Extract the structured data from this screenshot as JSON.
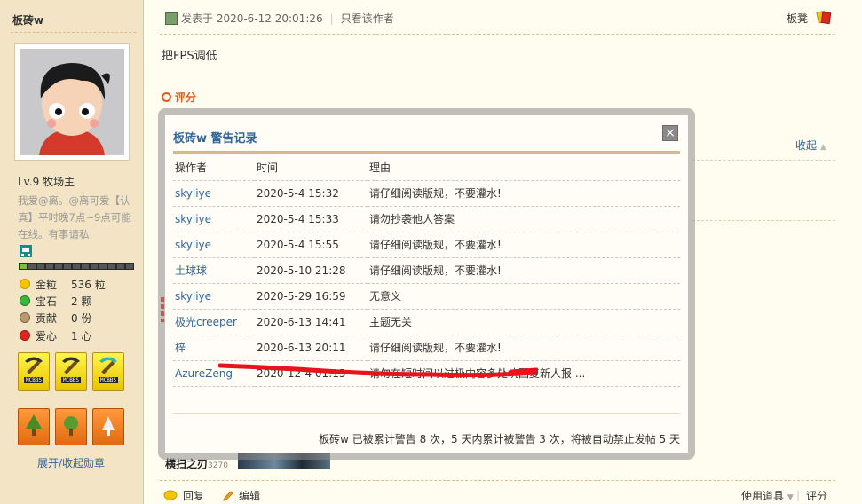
{
  "sidebar": {
    "username": "板砖w",
    "level": "Lv.9 牧场主",
    "bio": "我爱@离。@离可爱【认真】平时晚7点~9点可能在线。有事请私",
    "xp_fraction": 0.06,
    "stats": [
      {
        "icon": "gold-coin-icon",
        "color": "#f5c400",
        "label": "金粒",
        "value": "536 粒"
      },
      {
        "icon": "gem-icon",
        "color": "#3ab83a",
        "label": "宝石",
        "value": "2 颗"
      },
      {
        "icon": "contribution-icon",
        "color": "#b99a6e",
        "label": "贡献",
        "value": "0 份"
      },
      {
        "icon": "heart-apple-icon",
        "color": "#e0261e",
        "label": "爱心",
        "value": "1 心"
      }
    ],
    "medal_tag": "MCBBS",
    "toggle_medals": "展开/收起勋章"
  },
  "post": {
    "posted_at": "发表于 2020-6-12 20:01:26",
    "only_author": "只看该作者",
    "floor": "板凳",
    "content": "把FPS调低",
    "rate": "评分",
    "collapse": "收起",
    "bg_weapon": "横扫之刃",
    "bg_weapon_num": "3270"
  },
  "footer": {
    "reply": "回复",
    "edit": "编辑",
    "tools": "使用道具",
    "rate": "评分"
  },
  "modal": {
    "title": "板砖w 警告记录",
    "close": "×",
    "columns": [
      "操作者",
      "时间",
      "理由"
    ],
    "rows": [
      {
        "operator": "skyliye",
        "time": "2020-5-4 15:32",
        "reason": "请仔细阅读版规，不要灌水!"
      },
      {
        "operator": "skyliye",
        "time": "2020-5-4 15:33",
        "reason": "请勿抄袭他人答案"
      },
      {
        "operator": "skyliye",
        "time": "2020-5-4 15:55",
        "reason": "请仔细阅读版规，不要灌水!"
      },
      {
        "operator": "土球球",
        "time": "2020-5-10 21:28",
        "reason": "请仔细阅读版规，不要灌水!"
      },
      {
        "operator": "skyliye",
        "time": "2020-5-29 16:59",
        "reason": "无意义"
      },
      {
        "operator": "极光creeper",
        "time": "2020-6-13 14:41",
        "reason": "主题无关"
      },
      {
        "operator": "梓",
        "time": "2020-6-13 20:11",
        "reason": "请仔细阅读版规，不要灌水!"
      },
      {
        "operator": "AzureZeng",
        "time": "2020-12-4 01:15",
        "reason": "请勿在短时间以过极内容多处坑回复新人报 ..."
      }
    ],
    "summary": "板砖w 已被累计警告 8 次，5 天内累计被警告 3 次，将被自动禁止发帖 5 天"
  },
  "colors": {
    "link": "#336699",
    "rate_orange": "#e05a1e",
    "sidebar_bg": "#f2e4c4",
    "scribble_red": "#e8141c"
  }
}
